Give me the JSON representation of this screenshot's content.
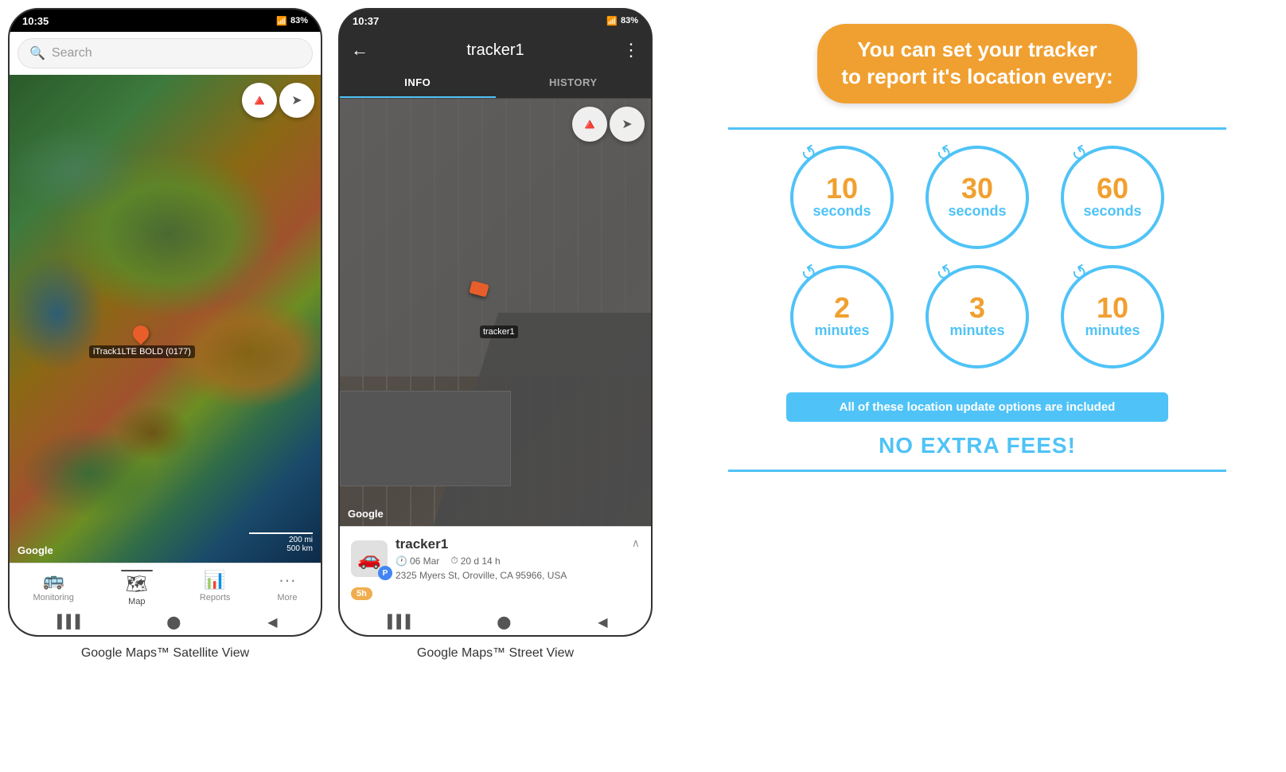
{
  "leftPhone": {
    "statusTime": "10:35",
    "statusBattery": "83%",
    "searchPlaceholder": "Search",
    "compassSymbol": "🧭",
    "trackerLabel": "iTrack1LTE BOLD (0177)",
    "googleLogo": "Google",
    "scaleText1": "200 mi",
    "scaleText2": "500 km",
    "navItems": [
      {
        "label": "Monitoring",
        "icon": "🚌",
        "active": false
      },
      {
        "label": "Map",
        "icon": "🗺",
        "active": true
      },
      {
        "label": "Reports",
        "icon": "📊",
        "active": false
      },
      {
        "label": "More",
        "icon": "···",
        "active": false
      }
    ],
    "caption": "Google Maps™ Satellite View"
  },
  "rightPhone": {
    "statusTime": "10:37",
    "statusBattery": "83%",
    "trackerName": "tracker1",
    "tabs": [
      "INFO",
      "HISTORY"
    ],
    "activeTab": "INFO",
    "googleLogo": "Google",
    "trackerInfo": {
      "name": "tracker1",
      "date": "06 Mar",
      "duration": "20 d 14 h",
      "address": "2325 Myers St, Oroville, CA 95966, USA",
      "batteryLabel": "5h",
      "vehicleIconLabel": "🚗"
    },
    "caption": "Google Maps™ Street View"
  },
  "infoPanel": {
    "headline": "You can set your tracker\nto report it's location every:",
    "intervals": [
      {
        "number": "10",
        "unit": "seconds"
      },
      {
        "number": "30",
        "unit": "seconds"
      },
      {
        "number": "60",
        "unit": "seconds"
      },
      {
        "number": "2",
        "unit": "minutes"
      },
      {
        "number": "3",
        "unit": "minutes"
      },
      {
        "number": "10",
        "unit": "minutes"
      }
    ],
    "includedText": "All of these location update options are included",
    "noFeesText": "NO EXTRA FEES!"
  }
}
